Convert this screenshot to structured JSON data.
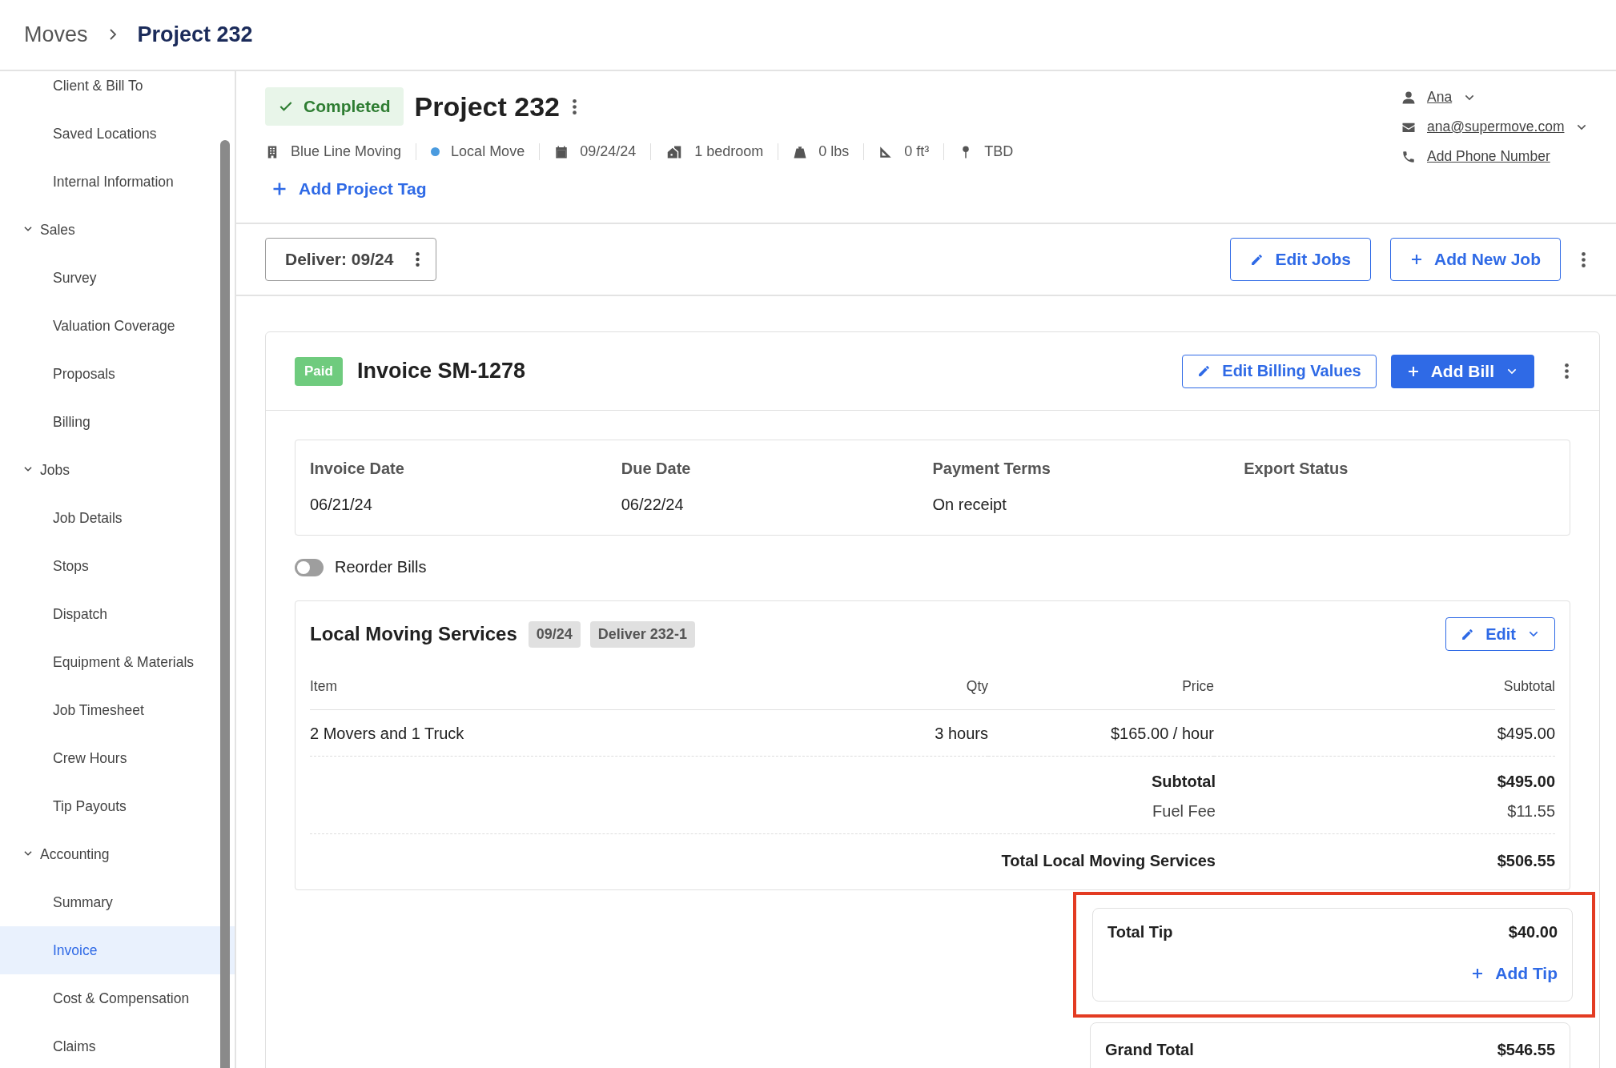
{
  "breadcrumb": [
    {
      "label": "Moves",
      "current": false
    },
    {
      "label": "Project 232",
      "current": true
    }
  ],
  "sidebar": {
    "items": [
      {
        "kind": "item",
        "label": "Client & Bill To",
        "selected": false
      },
      {
        "kind": "item",
        "label": "Saved Locations",
        "selected": false
      },
      {
        "kind": "item",
        "label": "Internal Information",
        "selected": false
      },
      {
        "kind": "group",
        "label": "Sales",
        "expanded": true,
        "children": [
          {
            "label": "Survey",
            "selected": false
          },
          {
            "label": "Valuation Coverage",
            "selected": false
          },
          {
            "label": "Proposals",
            "selected": false
          },
          {
            "label": "Billing",
            "selected": false
          }
        ]
      },
      {
        "kind": "group",
        "label": "Jobs",
        "expanded": true,
        "children": [
          {
            "label": "Job Details",
            "selected": false
          },
          {
            "label": "Stops",
            "selected": false
          },
          {
            "label": "Dispatch",
            "selected": false
          },
          {
            "label": "Equipment & Materials",
            "selected": false
          },
          {
            "label": "Job Timesheet",
            "selected": false
          },
          {
            "label": "Crew Hours",
            "selected": false
          },
          {
            "label": "Tip Payouts",
            "selected": false
          }
        ]
      },
      {
        "kind": "group",
        "label": "Accounting",
        "expanded": true,
        "children": [
          {
            "label": "Summary",
            "selected": false
          },
          {
            "label": "Invoice",
            "selected": true
          },
          {
            "label": "Cost & Compensation",
            "selected": false
          },
          {
            "label": "Claims",
            "selected": false
          }
        ]
      }
    ]
  },
  "project": {
    "status": "Completed",
    "title": "Project 232",
    "meta": [
      {
        "kind": "building",
        "text": "Blue Line Moving"
      },
      {
        "kind": "dot",
        "text": "Local Move"
      },
      {
        "kind": "calendar",
        "text": "09/24/24"
      },
      {
        "kind": "house",
        "text": "1 bedroom"
      },
      {
        "kind": "weight",
        "text": "0 lbs"
      },
      {
        "kind": "ruler",
        "text": "0 ft³"
      },
      {
        "kind": "pin",
        "text": "TBD"
      }
    ],
    "add_tag": "Add Project Tag",
    "contact": [
      {
        "kind": "person",
        "text": "Ana",
        "dropdown": true
      },
      {
        "kind": "email",
        "text": "ana@supermove.com",
        "dropdown": true
      },
      {
        "kind": "phone",
        "text": "Add Phone Number",
        "dropdown": false
      }
    ]
  },
  "jobs_bar": {
    "job": "Deliver: 09/24",
    "edit": "Edit Jobs",
    "add": "Add New Job"
  },
  "invoice": {
    "badge": "Paid",
    "title": "Invoice SM-1278",
    "edit": "Edit Billing Values",
    "add": "Add Bill",
    "fields": [
      {
        "label": "Invoice Date",
        "value": "06/21/24"
      },
      {
        "label": "Due Date",
        "value": "06/22/24"
      },
      {
        "label": "Payment Terms",
        "value": "On receipt"
      },
      {
        "label": "Export Status"
      }
    ],
    "reorder": {
      "label": "Reorder Bills",
      "on": false
    },
    "bill": {
      "title": "Local Moving Services",
      "tags": [
        "09/24",
        "Deliver 232-1"
      ],
      "edit": "Edit",
      "columns": [
        "Item",
        "Qty",
        "Price",
        "Subtotal"
      ],
      "rows": [
        [
          "2 Movers and 1 Truck",
          "3 hours",
          "$165.00 / hour",
          "$495.00"
        ]
      ],
      "summary": [
        {
          "label": "Subtotal",
          "value": "$495.00",
          "bold": true
        },
        {
          "label": "Fuel Fee",
          "value": "$11.55",
          "bold": false
        }
      ],
      "total": {
        "label": "Total Local Moving Services",
        "value": "$506.55"
      }
    },
    "tip": {
      "label": "Total Tip",
      "value": "$40.00",
      "add": "Add Tip",
      "highlighted": true
    },
    "grand_total": {
      "label": "Grand Total",
      "value": "$546.55"
    }
  }
}
